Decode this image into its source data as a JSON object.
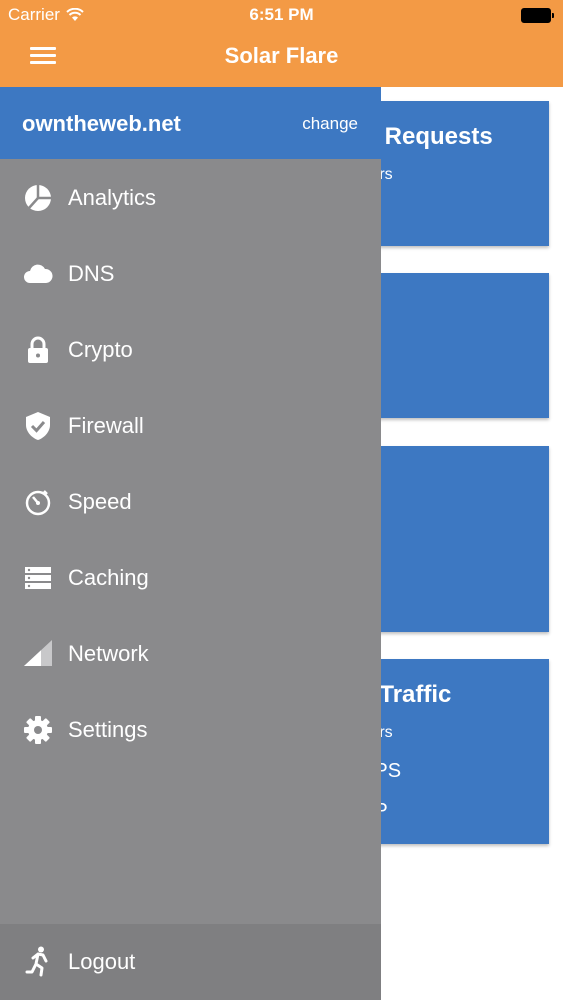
{
  "status_bar": {
    "carrier": "Carrier",
    "time": "6:51 PM"
  },
  "header": {
    "title": "Solar Flare"
  },
  "background_cards": [
    {
      "title": "ed Requests",
      "subtitle": "Hours"
    },
    {
      "title": "",
      "subtitle": ""
    },
    {
      "title": "",
      "subtitle": ""
    },
    {
      "title": "re Traffic",
      "subtitle": "Hours",
      "lines": [
        "TTPS",
        "TTP"
      ]
    }
  ],
  "drawer": {
    "domain": "owntheweb.net",
    "change_label": "change",
    "items": [
      {
        "label": "Analytics",
        "icon": "pie-chart-icon"
      },
      {
        "label": "DNS",
        "icon": "cloud-icon"
      },
      {
        "label": "Crypto",
        "icon": "lock-icon"
      },
      {
        "label": "Firewall",
        "icon": "shield-check-icon"
      },
      {
        "label": "Speed",
        "icon": "stopwatch-icon"
      },
      {
        "label": "Caching",
        "icon": "server-icon"
      },
      {
        "label": "Network",
        "icon": "signal-icon"
      },
      {
        "label": "Settings",
        "icon": "gear-icon"
      }
    ],
    "logout_label": "Logout"
  },
  "colors": {
    "header_orange": "#f39a45",
    "accent_blue": "#3d78c2",
    "drawer_gray": "#8a8a8c",
    "logout_gray": "#7f7f81"
  }
}
